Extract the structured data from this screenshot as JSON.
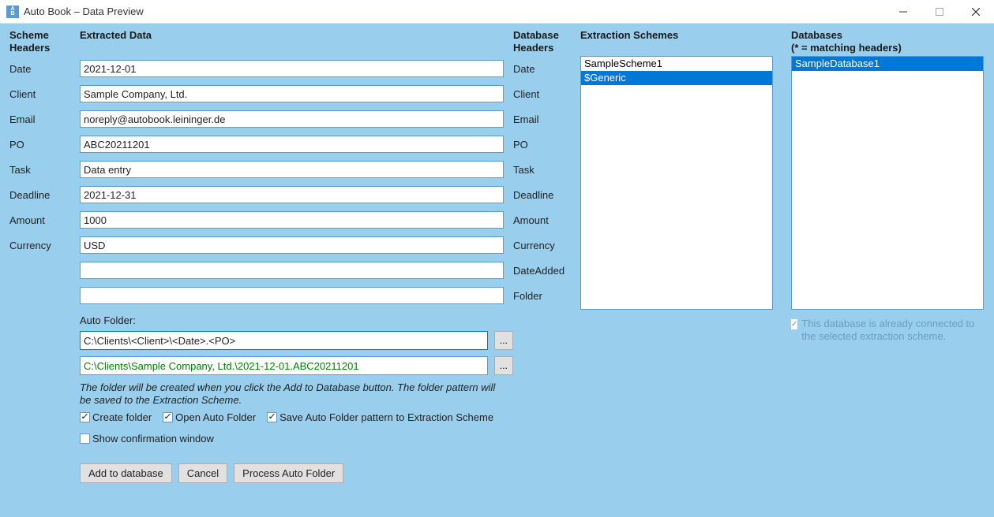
{
  "window": {
    "title": "Auto Book – Data Preview",
    "icon_top": "A",
    "icon_bottom": "B"
  },
  "columns": {
    "scheme_headers": "Scheme Headers",
    "extracted_data": "Extracted Data",
    "db_headers": "Database Headers",
    "schemes": "Extraction Schemes",
    "databases_line1": "Databases",
    "databases_line2": "(* = matching headers)"
  },
  "rows": [
    {
      "scheme": "Date",
      "value": "2021-12-01",
      "db": "Date"
    },
    {
      "scheme": "Client",
      "value": "Sample Company, Ltd.",
      "db": "Client"
    },
    {
      "scheme": "Email",
      "value": "noreply@autobook.leininger.de",
      "db": "Email"
    },
    {
      "scheme": "PO",
      "value": "ABC20211201",
      "db": "PO"
    },
    {
      "scheme": "Task",
      "value": "Data entry",
      "db": "Task"
    },
    {
      "scheme": "Deadline",
      "value": "2021-12-31",
      "db": "Deadline"
    },
    {
      "scheme": "Amount",
      "value": "1000",
      "db": "Amount"
    },
    {
      "scheme": "Currency",
      "value": "USD",
      "db": "Currency"
    },
    {
      "scheme": "",
      "value": "",
      "db": "DateAdded"
    },
    {
      "scheme": "",
      "value": "",
      "db": "Folder"
    }
  ],
  "auto_folder": {
    "label": "Auto Folder:",
    "pattern": "C:\\Clients\\<Client>\\<Date>.<PO>",
    "resolved": "C:\\Clients\\Sample Company, Ltd.\\2021-12-01.ABC20211201",
    "browse": "...",
    "hint": "The folder will be created when you click the Add to Database button. The folder pattern will be saved to the Extraction Scheme."
  },
  "checks": {
    "create_folder": "Create folder",
    "open_auto_folder": "Open Auto Folder",
    "save_pattern": "Save Auto Folder pattern to Extraction Scheme",
    "show_confirm": "Show confirmation window"
  },
  "buttons": {
    "add": "Add to database",
    "cancel": "Cancel",
    "process": "Process Auto Folder"
  },
  "schemes": {
    "items": [
      {
        "name": "SampleScheme1",
        "selected": false
      },
      {
        "name": "$Generic",
        "selected": true
      }
    ]
  },
  "databases": {
    "items": [
      {
        "name": "SampleDatabase1",
        "selected": true
      }
    ],
    "note": "This database is already connected to the selected extraction scheme."
  }
}
